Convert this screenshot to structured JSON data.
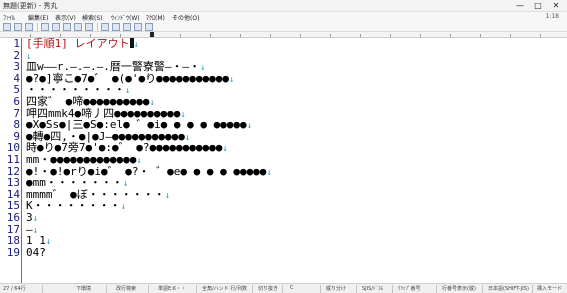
{
  "window": {
    "title": "無題(更新) - 秀丸",
    "minimize_glyph": "—",
    "maximize_glyph": "□",
    "close_glyph": "✕"
  },
  "menu": {
    "items": [
      "ﾌｧｲﾙ",
      "編集(E)",
      "表示(V)",
      "検索(S)",
      "ｳｨﾝﾄﾞｳ(W)",
      "ﾏｸﾛ(M)",
      "その他(O)"
    ],
    "line_col": "1:18"
  },
  "toolbar": {
    "icons": [
      "new-file-icon",
      "open-file-icon",
      "save-icon",
      "cut-icon",
      "copy-icon",
      "paste-icon",
      "undo-icon",
      "redo-icon",
      "find-icon",
      "replace-icon",
      "grep-icon",
      "macro-icon",
      "settings-icon"
    ]
  },
  "editor": {
    "line_numbers": [
      "1",
      "2",
      "3",
      "4",
      "5",
      "6",
      "7",
      "8",
      "9",
      "10",
      "11",
      "12",
      "13",
      "14",
      "15",
      "16",
      "17",
      "18",
      "19"
    ],
    "eol_glyph": "↓",
    "lines": [
      "[手順1] レイアウト",
      "",
      "皿w――r.―.―.―.暦一警寮警―・―・",
      "●?●]寧こ●7●゛ ●(●'●り●●●●●●●●●●●",
      "・・・・・・・・・",
      "四家゛ ●啼●●●●●●●●●●",
      "呷四mmk4●啼丿四●●●●●●●●●●",
      "●X●Ss●|三●S●:el● ゛●i● ● ● ● ●●●●●",
      "●轉●四,・●|●J―●●●●●●●●●●●",
      "時●り●7旁7●'●:●゛ ●?●●●●●●●●●●●",
      "mm・●●●●●●●●●●●●●",
      "●!・●!●rり●i●゛ ●?・ ゛●e● ● ● ● ●●●●●",
      "●mm・・・・・・・",
      "mmmm゛ ●ぼ・・・・・・・",
      "K・・・・・・・・",
      "3",
      "―",
      "1 1",
      "04?"
    ]
  },
  "status": {
    "items": [
      "27 / 64行",
      "下環境",
      "改行検索",
      "単語E:K・・",
      "全角/ハンド 行/列数",
      "切り抜き",
      "C",
      "縦り分け",
      "SJIS/ﾄﾞｺﾓ",
      "ｸﾘｯﾌﾟ番号",
      "行番号表示(縦)",
      "日本語(SHIFT-JIS)",
      "挿入モード"
    ]
  }
}
